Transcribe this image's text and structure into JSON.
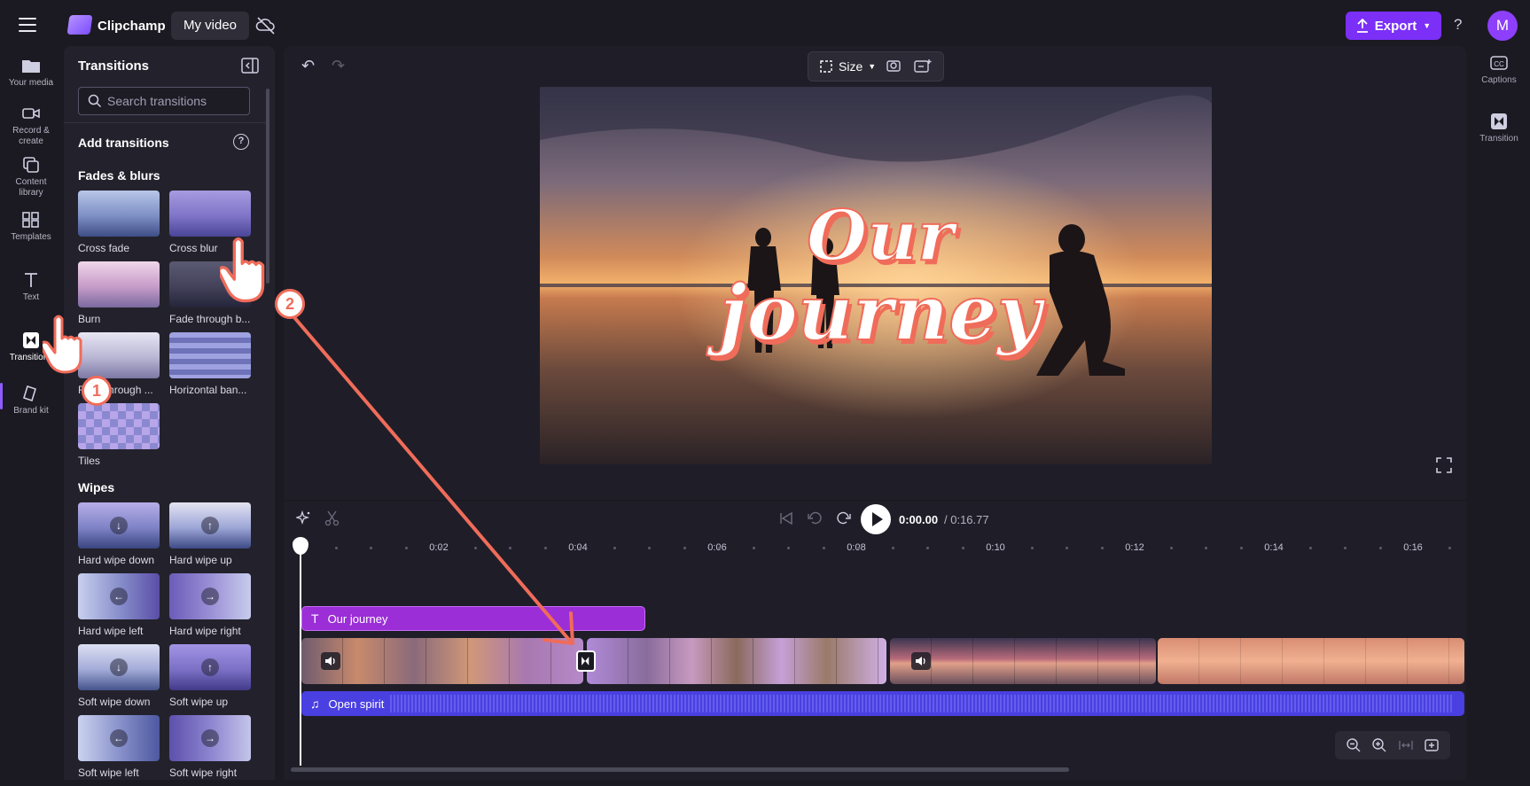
{
  "app": {
    "name": "Clipchamp",
    "project_tab": "My video",
    "export_label": "Export",
    "help": "?",
    "avatar_initial": "M"
  },
  "leftnav": {
    "items": [
      {
        "label": "Your media"
      },
      {
        "label": "Record &\ncreate"
      },
      {
        "label": "Content\nlibrary"
      },
      {
        "label": "Templates"
      },
      {
        "label": "Text"
      },
      {
        "label": "Transitions"
      },
      {
        "label": "Brand kit"
      }
    ]
  },
  "panel": {
    "title": "Transitions",
    "search_placeholder": "Search transitions",
    "add_label": "Add transitions",
    "help": "?",
    "sections": [
      {
        "title": "Fades & blurs",
        "items": [
          "Cross fade",
          "Cross blur",
          "Burn",
          "Fade through b...",
          "Fade through ...",
          "Horizontal ban...",
          "Tiles"
        ]
      },
      {
        "title": "Wipes",
        "items": [
          "Hard wipe down",
          "Hard wipe up",
          "Hard wipe left",
          "Hard wipe right",
          "Soft wipe down",
          "Soft wipe up",
          "Soft wipe left",
          "Soft wipe right"
        ]
      }
    ],
    "wipe_arrows": [
      "↓",
      "↑",
      "←",
      "→",
      "↓",
      "↑",
      "←",
      "→"
    ]
  },
  "editor": {
    "size_label": "Size",
    "preview_title_line1": "Our",
    "preview_title_line2": "journey"
  },
  "rightbar": {
    "items": [
      {
        "label": "Captions"
      },
      {
        "label": "Transition"
      }
    ]
  },
  "playback": {
    "current_time": "0:00.00",
    "total_time": "/ 0:16.77"
  },
  "ruler": {
    "labels": [
      "0:02",
      "0:04",
      "0:06",
      "0:08",
      "0:10",
      "0:12",
      "0:14",
      "0:16"
    ]
  },
  "tracks": {
    "text_clip": "Our journey",
    "audio_clip": "Open spirit"
  },
  "annotations": {
    "step1": "1",
    "step2": "2"
  },
  "colors": {
    "accent": "#7b2ff7",
    "text_track": "#9b2ed6",
    "audio_track": "#4a3fe0",
    "annotation": "#f06c5a"
  }
}
